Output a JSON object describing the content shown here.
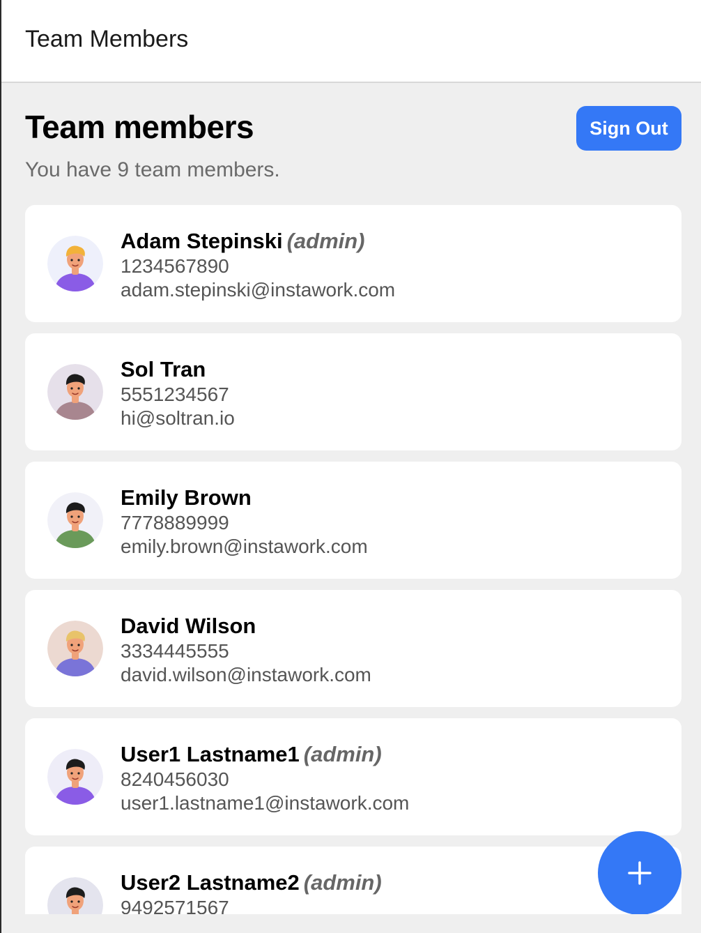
{
  "header": {
    "title": "Team Members"
  },
  "main": {
    "heading": "Team members",
    "subtitle": "You have 9 team members.",
    "signout_label": "Sign Out"
  },
  "members": [
    {
      "name": "Adam Stepinski",
      "role": "(admin)",
      "phone": "1234567890",
      "email": "adam.stepinski@instawork.com",
      "avatar": "avatar-adam-icon",
      "bg": "#eef0fb",
      "shirt": "#8a5ce6",
      "hair": "#f2b23a",
      "skin": "#f0a27a"
    },
    {
      "name": "Sol Tran",
      "role": "",
      "phone": "5551234567",
      "email": "hi@soltran.io",
      "avatar": "avatar-sol-icon",
      "bg": "#e6e0ea",
      "shirt": "#a8868f",
      "hair": "#1c1c1c",
      "skin": "#f0a27a"
    },
    {
      "name": "Emily Brown",
      "role": "",
      "phone": "7778889999",
      "email": "emily.brown@instawork.com",
      "avatar": "avatar-emily-icon",
      "bg": "#f1f1f8",
      "shirt": "#6a9a5a",
      "hair": "#1c1c1c",
      "skin": "#f0a27a"
    },
    {
      "name": "David Wilson",
      "role": "",
      "phone": "3334445555",
      "email": "david.wilson@instawork.com",
      "avatar": "avatar-david-icon",
      "bg": "#ecd9d1",
      "shirt": "#7a74d8",
      "hair": "#e8c36a",
      "skin": "#f0a27a"
    },
    {
      "name": "User1 Lastname1",
      "role": "(admin)",
      "phone": "8240456030",
      "email": "user1.lastname1@instawork.com",
      "avatar": "avatar-user1-icon",
      "bg": "#eeedf8",
      "shirt": "#8a5ce6",
      "hair": "#1c1c1c",
      "skin": "#f0a27a"
    },
    {
      "name": "User2 Lastname2",
      "role": "(admin)",
      "phone": "9492571567",
      "email": "",
      "avatar": "avatar-user2-icon",
      "bg": "#e4e4ee",
      "shirt": "#5a6ab0",
      "hair": "#1c1c1c",
      "skin": "#f0a27a"
    }
  ],
  "fab": {
    "icon": "plus-icon"
  },
  "colors": {
    "accent": "#3478f6",
    "background": "#efefef",
    "card": "#ffffff"
  }
}
